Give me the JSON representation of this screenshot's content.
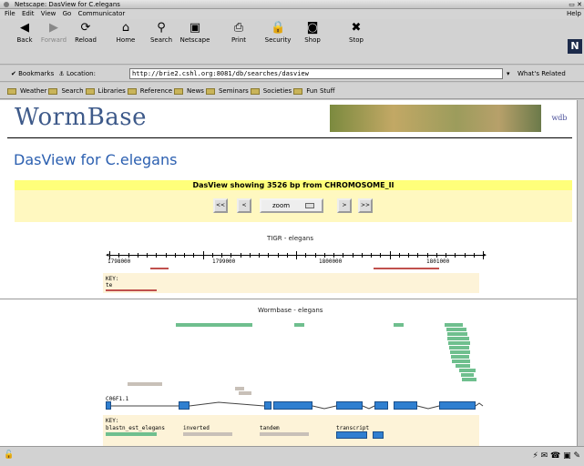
{
  "window": {
    "title": "Netscape: DasView for C.elegans"
  },
  "menu": {
    "items": [
      "File",
      "Edit",
      "View",
      "Go",
      "Communicator"
    ],
    "help": "Help"
  },
  "toolbar": [
    {
      "label": "Back",
      "icon": "back-arrow-icon",
      "glyph": "◀",
      "enabled": true
    },
    {
      "label": "Forward",
      "icon": "forward-arrow-icon",
      "glyph": "▶",
      "enabled": false
    },
    {
      "label": "Reload",
      "icon": "reload-icon",
      "glyph": "⟳",
      "enabled": true
    },
    {
      "label": "Home",
      "icon": "home-icon",
      "glyph": "⌂",
      "enabled": true
    },
    {
      "label": "Search",
      "icon": "search-icon",
      "glyph": "⚲",
      "enabled": true
    },
    {
      "label": "Netscape",
      "icon": "netscape-icon",
      "glyph": "▣",
      "enabled": true
    },
    {
      "label": "Print",
      "icon": "print-icon",
      "glyph": "⎙",
      "enabled": true
    },
    {
      "label": "Security",
      "icon": "lock-icon",
      "glyph": "🔒",
      "enabled": true
    },
    {
      "label": "Shop",
      "icon": "shop-icon",
      "glyph": "◙",
      "enabled": true
    },
    {
      "label": "Stop",
      "icon": "stop-icon",
      "glyph": "✖",
      "enabled": true
    }
  ],
  "brand": {
    "letter": "N"
  },
  "location": {
    "bookmarks_label": "Bookmarks",
    "location_label": "Location:",
    "url": "http://brie2.cshl.org:8081/db/searches/dasview",
    "related": "What's Related"
  },
  "personal": [
    "Weather",
    "Search",
    "Libraries",
    "Reference",
    "News",
    "Seminars",
    "Societies",
    "Fun Stuff"
  ],
  "page": {
    "logo": "WormBase",
    "wdb": "wdb",
    "title": "DasView for C.elegans",
    "showing": "DasView showing 3526 bp from CHROMOSOME_II",
    "nav": {
      "first": "<<",
      "prev": "<",
      "zoom": "zoom",
      "next": ">",
      "last": ">>"
    },
    "tigr": {
      "heading": "TIGR - elegans",
      "ticks": [
        "1798000",
        "1799000",
        "1800000",
        "1801000"
      ],
      "key": "KEY:",
      "key_item": "te"
    },
    "wormbase": {
      "heading": "Wormbase - elegans",
      "gene": "C06F1.1",
      "key": "KEY:",
      "key_items": [
        "blastn_est_elegans",
        "inverted",
        "tandem",
        "transcript"
      ]
    }
  },
  "colors": {
    "est": "#6fbf8e",
    "transcript": "#2f7fd0",
    "te": "#c0504d",
    "repeat": "#c8c0b8",
    "yellow": "#ffff7a",
    "key_bg": "#fdf3d8",
    "link": "#2b5fb0"
  }
}
